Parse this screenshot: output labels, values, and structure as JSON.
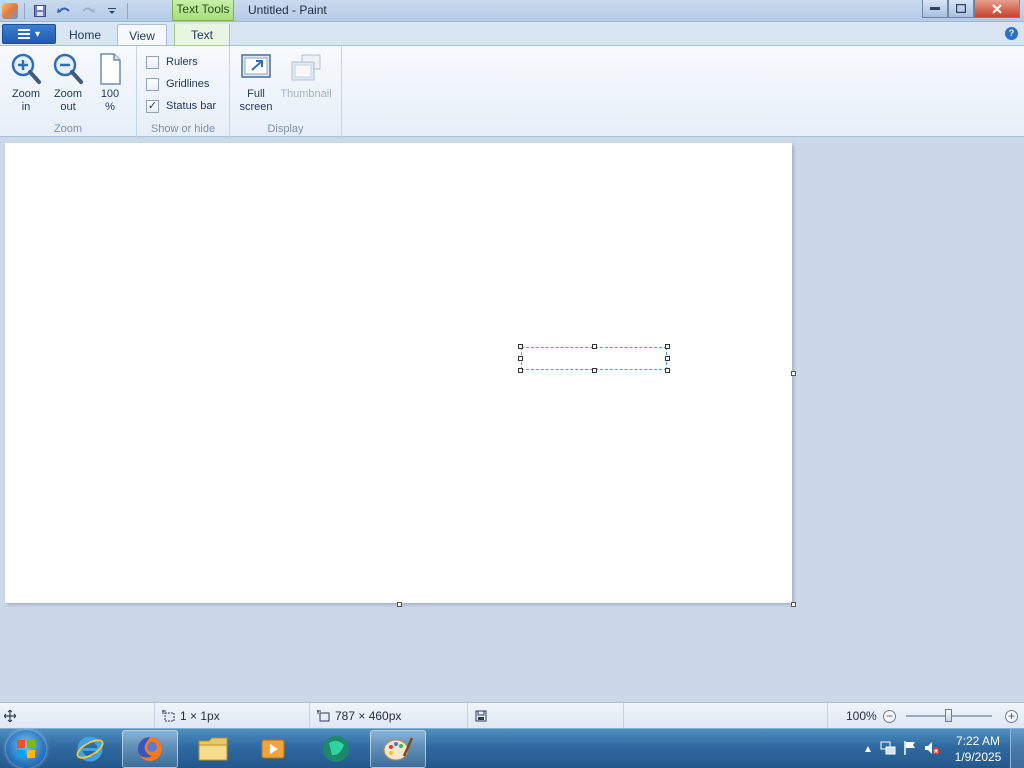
{
  "window": {
    "title": "Untitled - Paint",
    "contextual_tab_group": "Text Tools"
  },
  "ribbon_tabs": {
    "home": "Home",
    "view": "View",
    "text": "Text"
  },
  "zoom_group": {
    "label": "Zoom",
    "zoom_in": "Zoom\nin",
    "zoom_out": "Zoom\nout",
    "zoom_100": "100\n%"
  },
  "show_hide_group": {
    "label": "Show or hide",
    "rulers": {
      "label": "Rulers",
      "checked": false
    },
    "gridlines": {
      "label": "Gridlines",
      "checked": false
    },
    "status_bar": {
      "label": "Status bar",
      "checked": true,
      "check_mark": "✓"
    }
  },
  "display_group": {
    "label": "Display",
    "full_screen": "Full\nscreen",
    "thumbnail": "Thumbnail"
  },
  "status": {
    "selection_size": "1 × 1px",
    "image_size": "787 × 460px",
    "zoom_level": "100%",
    "zoom_fraction": 0.5
  },
  "taskbar": {
    "apps": [
      "internet-explorer",
      "firefox",
      "file-explorer",
      "media-player",
      "app-green",
      "paint"
    ],
    "time": "7:22 AM",
    "date": "1/9/2025"
  },
  "colors": {
    "accent": "#2b6fc8",
    "text_tools_tab": "#a7dd7a",
    "selection_dash": "#4f98d5"
  }
}
